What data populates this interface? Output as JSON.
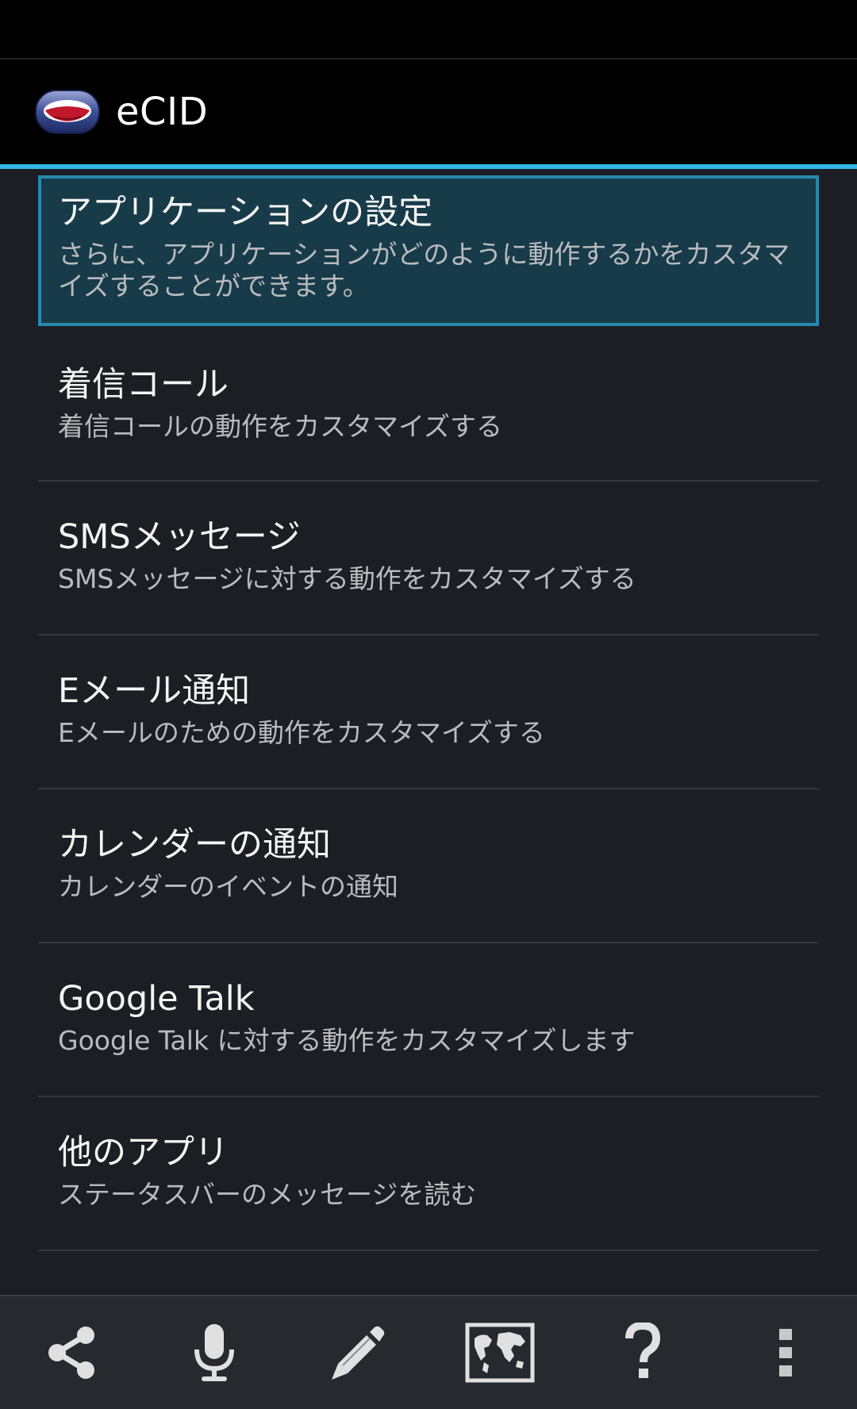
{
  "app": {
    "title": "eCID",
    "logo_icon": "ecid-logo-icon"
  },
  "colors": {
    "accent": "#33b5e5",
    "selected_bg": "#173b49",
    "background": "#1b1e23"
  },
  "preferences": [
    {
      "title": "アプリケーションの設定",
      "summary": "さらに、アプリケーションがどのように動作するかをカスタマイズすることができます。",
      "selected": true
    },
    {
      "title": "着信コール",
      "summary": "着信コールの動作をカスタマイズする"
    },
    {
      "title": "SMSメッセージ",
      "summary": "SMSメッセージに対する動作をカスタマイズする"
    },
    {
      "title": "Eメール通知",
      "summary": "Eメールのための動作をカスタマイズする"
    },
    {
      "title": "カレンダーの通知",
      "summary": "カレンダーのイベントの通知"
    },
    {
      "title": "Google Talk",
      "summary": "Google Talk に対する動作をカスタマイズします"
    },
    {
      "title": "他のアプリ",
      "summary": "ステータスバーのメッセージを読む"
    }
  ],
  "bottom_bar": {
    "icons": [
      "share-icon",
      "microphone-icon",
      "pencil-icon",
      "world-map-icon",
      "help-icon",
      "overflow-menu-icon"
    ]
  }
}
